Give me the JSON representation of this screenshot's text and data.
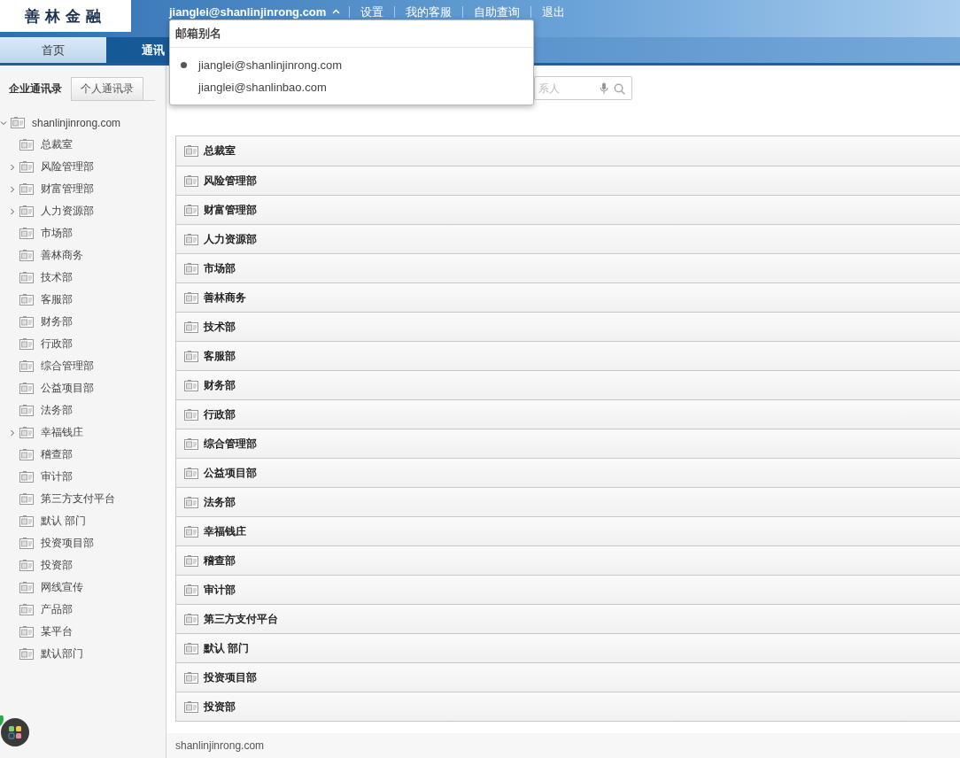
{
  "logo": {
    "text": "善林金融"
  },
  "header": {
    "account": "jianglei@shanlinjinrong.com",
    "links": [
      "设置",
      "我的客服",
      "自助查询",
      "退出"
    ]
  },
  "nav": {
    "tabs": [
      {
        "label": "首页",
        "selected": false
      },
      {
        "label": "通讯",
        "selected": true
      }
    ]
  },
  "alias_menu": {
    "title": "邮箱别名",
    "items": [
      {
        "label": "jianglei@shanlinjinrong.com",
        "selected": true
      },
      {
        "label": "jianglei@shanlinbao.com",
        "selected": false
      }
    ]
  },
  "sidebar": {
    "tabs": [
      {
        "label": "企业通讯录",
        "selected": true
      },
      {
        "label": "个人通讯录",
        "selected": false
      }
    ],
    "tree": [
      {
        "label": "shanlinjinrong.com",
        "expanded": true,
        "children": [
          {
            "label": "总裁室",
            "expandable": false
          },
          {
            "label": "风险管理部",
            "expandable": true
          },
          {
            "label": "财富管理部",
            "expandable": true
          },
          {
            "label": "人力资源部",
            "expandable": true
          },
          {
            "label": "市场部",
            "expandable": false
          },
          {
            "label": "善林商务",
            "expandable": false
          },
          {
            "label": "技术部",
            "expandable": false
          },
          {
            "label": "客服部",
            "expandable": false
          },
          {
            "label": "财务部",
            "expandable": false
          },
          {
            "label": "行政部",
            "expandable": false
          },
          {
            "label": "综合管理部",
            "expandable": false
          },
          {
            "label": "公益项目部",
            "expandable": false
          },
          {
            "label": "法务部",
            "expandable": false
          },
          {
            "label": "幸福钱庄",
            "expandable": true
          },
          {
            "label": "稽查部",
            "expandable": false
          },
          {
            "label": "审计部",
            "expandable": false
          },
          {
            "label": "第三方支付平台",
            "expandable": false
          },
          {
            "label": "默认 部门",
            "expandable": false
          },
          {
            "label": "投资项目部",
            "expandable": false
          },
          {
            "label": "投资部",
            "expandable": false
          },
          {
            "label": "网线宣传",
            "expandable": false
          },
          {
            "label": "产品部",
            "expandable": false
          },
          {
            "label": "某平台",
            "expandable": false
          },
          {
            "label": "默认部门",
            "expandable": false
          }
        ]
      }
    ]
  },
  "search": {
    "placeholder": "系人"
  },
  "departments": [
    "总裁室",
    "风险管理部",
    "财富管理部",
    "人力资源部",
    "市场部",
    "善林商务",
    "技术部",
    "客服部",
    "财务部",
    "行政部",
    "综合管理部",
    "公益项目部",
    "法务部",
    "幸福钱庄",
    "稽查部",
    "审计部",
    "第三方支付平台",
    "默认 部门",
    "投资项目部",
    "投资部"
  ],
  "status_bar": {
    "text": "shanlinjinrong.com"
  }
}
